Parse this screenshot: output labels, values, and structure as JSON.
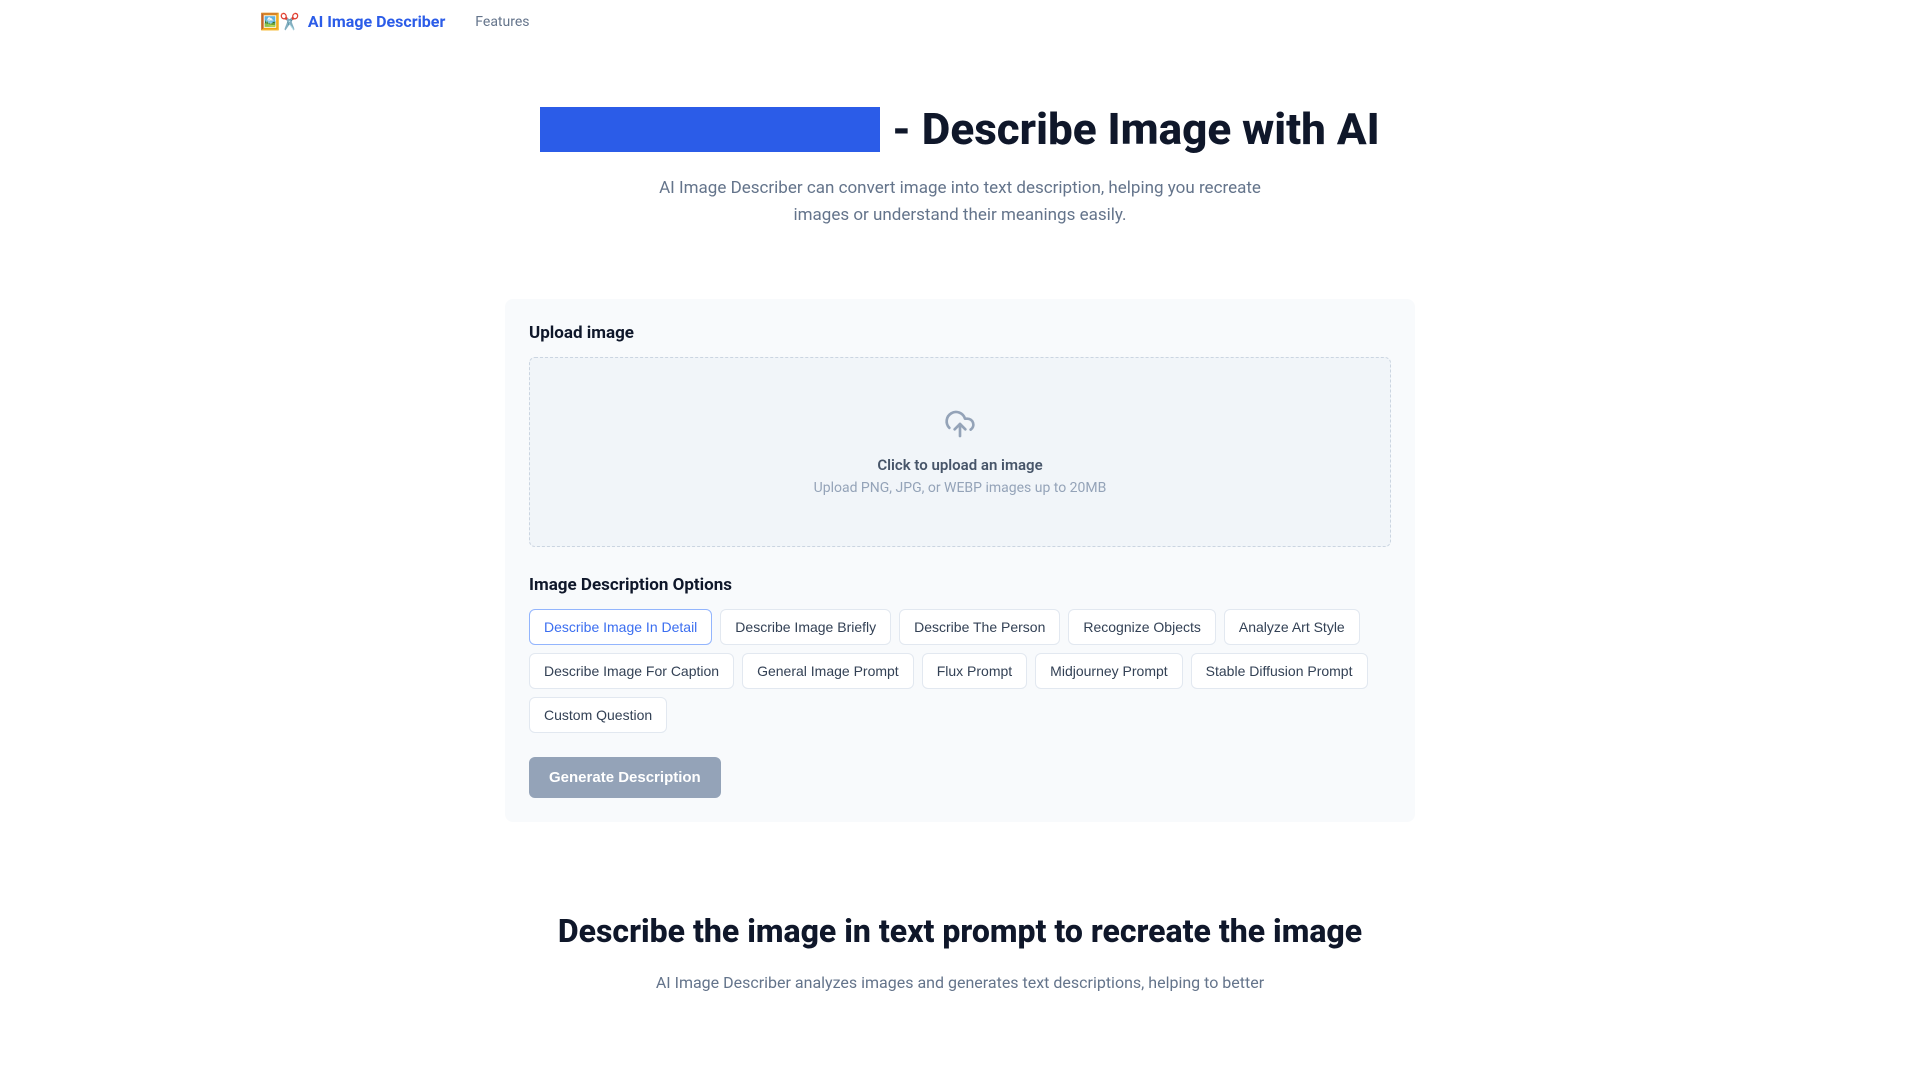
{
  "header": {
    "logo_text": "AI Image Describer",
    "nav": {
      "features": "Features"
    }
  },
  "hero": {
    "title_suffix": "- Describe Image with AI",
    "subtitle": "AI Image Describer can convert image into text description, helping you recreate images or understand their meanings easily."
  },
  "upload": {
    "section_title": "Upload image",
    "title": "Click to upload an image",
    "hint": "Upload PNG, JPG, or WEBP images up to 20MB"
  },
  "options": {
    "section_title": "Image Description Options",
    "items": [
      {
        "label": "Describe Image In Detail",
        "active": true
      },
      {
        "label": "Describe Image Briefly",
        "active": false
      },
      {
        "label": "Describe The Person",
        "active": false
      },
      {
        "label": "Recognize Objects",
        "active": false
      },
      {
        "label": "Analyze Art Style",
        "active": false
      },
      {
        "label": "Describe Image For Caption",
        "active": false
      },
      {
        "label": "General Image Prompt",
        "active": false
      },
      {
        "label": "Flux Prompt",
        "active": false
      },
      {
        "label": "Midjourney Prompt",
        "active": false
      },
      {
        "label": "Stable Diffusion Prompt",
        "active": false
      },
      {
        "label": "Custom Question",
        "active": false
      }
    ]
  },
  "generate_label": "Generate Description",
  "section2": {
    "title": "Describe the image in text prompt to recreate the image",
    "text": "AI Image Describer analyzes images and generates text descriptions, helping to better"
  }
}
